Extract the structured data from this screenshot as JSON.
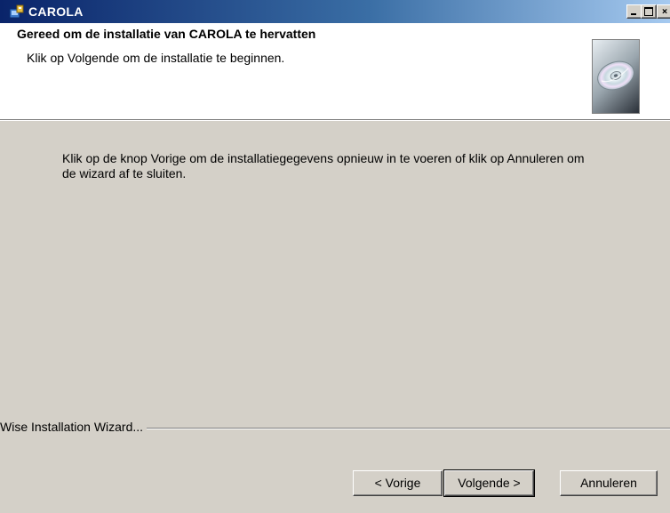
{
  "window": {
    "title": "CAROLA",
    "controls": {
      "minimize_icon": "minimize-icon",
      "maximize_icon": "maximize-icon",
      "close_icon": "close-icon"
    },
    "app_icon": "setup-icon"
  },
  "header": {
    "title": "Gereed om de installatie van CAROLA te hervatten",
    "subtitle": "Klik op Volgende om de installatie te beginnen.",
    "image_icon": "cd-icon"
  },
  "main": {
    "message": "Klik op de knop Vorige om de installatiegegevens opnieuw in te voeren of klik op Annuleren om de wizard af te sluiten."
  },
  "footer": {
    "branding": "Wise Installation Wizard...",
    "buttons": {
      "back": "< Vorige",
      "next": "Volgende >",
      "cancel": "Annuleren"
    }
  },
  "colors": {
    "titlebar_start": "#0a246a",
    "titlebar_end": "#a6caf0",
    "dialog_bg": "#d4d0c8",
    "header_bg": "#ffffff"
  }
}
